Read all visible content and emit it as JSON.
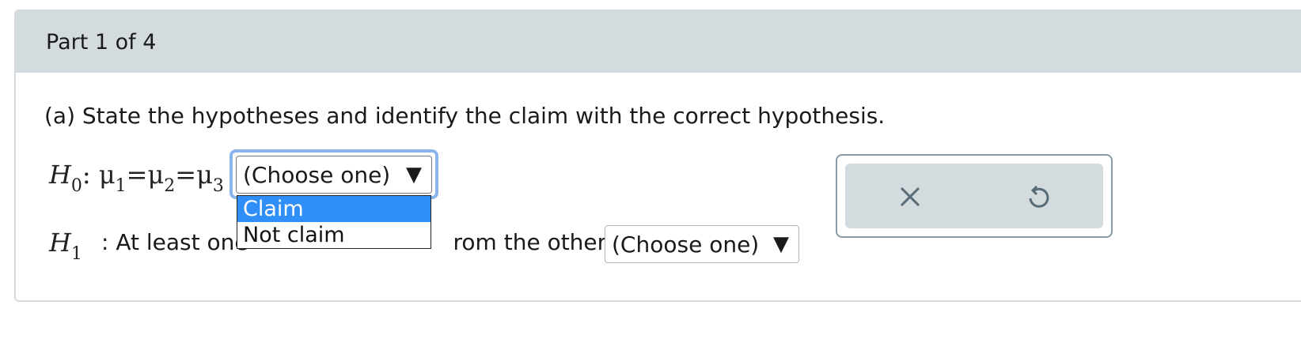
{
  "header": {
    "part_label": "Part 1 of 4"
  },
  "question": {
    "text": "(a) State the hypotheses and identify the claim with the correct hypothesis."
  },
  "h0": {
    "symbol": "H",
    "subscript": "0",
    "expression_parts": [
      "μ",
      "1",
      "=",
      "μ",
      "2",
      "=",
      "μ",
      "3"
    ],
    "select": {
      "value": "(Choose one)",
      "arrow": "▼",
      "open": true,
      "options": [
        "Claim",
        "Not claim"
      ],
      "highlighted_option": "Claim"
    }
  },
  "h1": {
    "symbol": "H",
    "subscript": "1",
    "text_before": ": At least one ",
    "text_after": "rom the others.",
    "select": {
      "value": "(Choose one)",
      "arrow": "▼"
    }
  },
  "tools": {
    "clear_icon": "close-icon",
    "undo_icon": "undo-icon"
  },
  "colors": {
    "header_bg": "#d3dbdf",
    "focus_ring": "#8ab4ec",
    "option_highlight": "#2f8ef7",
    "tool_icon": "#5a6b78"
  }
}
